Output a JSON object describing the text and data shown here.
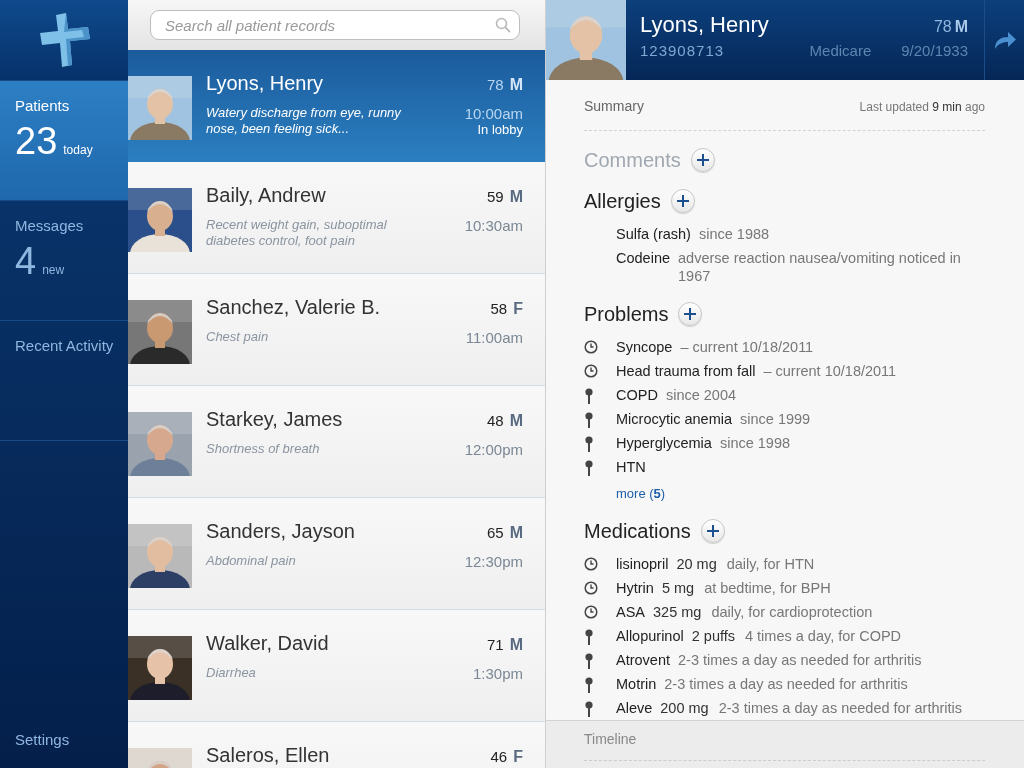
{
  "sidebar": {
    "items": [
      {
        "label": "Patients",
        "count": "23",
        "count_label": "today",
        "selected": true
      },
      {
        "label": "Messages",
        "count": "4",
        "count_label": "new",
        "selected": false
      },
      {
        "label": "Recent Activity",
        "selected": false
      }
    ],
    "settings": "Settings"
  },
  "search": {
    "placeholder": "Search all patient records"
  },
  "patients": [
    {
      "name": "Lyons, Henry",
      "age": "78",
      "sex": "M",
      "complaint": "Watery discharge from eye, runny nose, been feeling sick...",
      "time": "10:00am",
      "status": "In lobby",
      "selected": true
    },
    {
      "name": "Baily, Andrew",
      "age": "59",
      "sex": "M",
      "complaint": "Recent weight gain, suboptimal diabetes control, foot pain",
      "time": "10:30am",
      "selected": false
    },
    {
      "name": "Sanchez, Valerie B.",
      "age": "58",
      "sex": "F",
      "complaint": "Chest pain",
      "time": "11:00am",
      "selected": false
    },
    {
      "name": "Starkey, James",
      "age": "48",
      "sex": "M",
      "complaint": "Shortness of breath",
      "time": "12:00pm",
      "selected": false
    },
    {
      "name": "Sanders, Jayson",
      "age": "65",
      "sex": "M",
      "complaint": "Abdominal pain",
      "time": "12:30pm",
      "selected": false
    },
    {
      "name": "Walker, David",
      "age": "71",
      "sex": "M",
      "complaint": "Diarrhea",
      "time": "1:30pm",
      "selected": false
    },
    {
      "name": "Saleros, Ellen",
      "age": "46",
      "sex": "F",
      "selected": false
    }
  ],
  "detail": {
    "name": "Lyons, Henry",
    "id": "123908713",
    "insurance": "Medicare",
    "dob": "9/20/1933",
    "age": "78",
    "sex": "M",
    "summary_label": "Summary",
    "last_updated": "Last updated **9 min** ago",
    "sections": [
      {
        "title": "Comments",
        "disabled": true
      },
      {
        "title": "Allergies",
        "disabled": false,
        "items": [
          {
            "name": "Sulfa (rash)",
            "note": "since 1988"
          },
          {
            "name": "Codeine",
            "note": "adverse reaction nausea/vomiting noticed in 1967"
          }
        ]
      },
      {
        "title": "Problems",
        "disabled": false,
        "items": [
          {
            "kind": "clock",
            "name": "Syncope",
            "note": "– current 10/18/2011"
          },
          {
            "kind": "clock",
            "name": "Head trauma from fall",
            "note": "– current 10/18/2011"
          },
          {
            "kind": "pin",
            "name": "COPD",
            "note": "since 2004"
          },
          {
            "kind": "pin",
            "name": "Microcytic anemia",
            "note": "since 1999"
          },
          {
            "kind": "pin",
            "name": "Hyperglycemia",
            "note": "since 1998"
          },
          {
            "kind": "pin",
            "name": "HTN"
          }
        ],
        "more": "more (**5**)"
      },
      {
        "title": "Medications",
        "disabled": false,
        "items": [
          {
            "kind": "clock",
            "name": "lisinopril",
            "dose": "20 mg",
            "note": "daily, for HTN"
          },
          {
            "kind": "clock",
            "name": "Hytrin",
            "dose": "5 mg",
            "note": "at bedtime, for BPH"
          },
          {
            "kind": "clock",
            "name": "ASA",
            "dose": "325 mg",
            "note": "daily, for cardioprotection"
          },
          {
            "kind": "pin",
            "name": "Allopurinol",
            "dose": "2 puffs",
            "note": "4 times a day, for COPD"
          },
          {
            "kind": "pin",
            "name": "Atrovent",
            "note": "2-3 times a day as needed for arthritis"
          },
          {
            "kind": "pin",
            "name": "Motrin",
            "note": "2-3 times a day as needed for arthritis"
          },
          {
            "kind": "pin",
            "name": "Aleve",
            "dose": "200 mg",
            "note": "2-3 times a day as needed for arthritis"
          }
        ]
      }
    ],
    "timeline_label": "Timeline"
  }
}
